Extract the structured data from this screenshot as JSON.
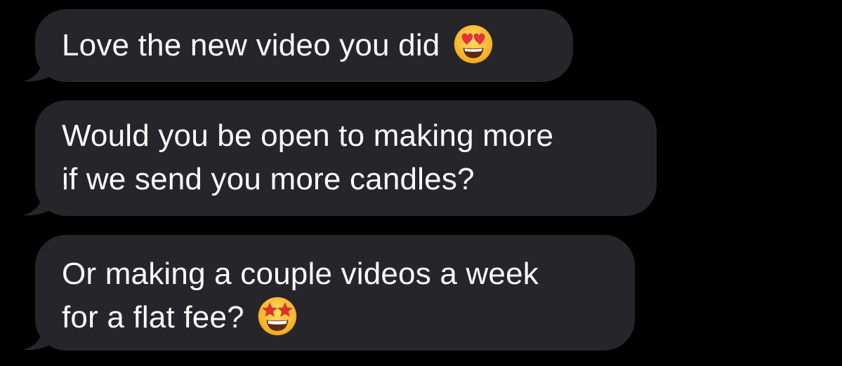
{
  "messages": [
    {
      "lines": [
        "Love the new video you did"
      ],
      "emoji": "heart-eyes-emoji"
    },
    {
      "lines": [
        "Would you be open to making more",
        "if we send you more candles?"
      ]
    },
    {
      "lines": [
        "Or making a couple videos a week",
        "for a flat fee?"
      ],
      "emoji": "star-struck-emoji"
    }
  ],
  "colors": {
    "background": "#000000",
    "bubble": "#26252a",
    "text": "#ffffff"
  }
}
